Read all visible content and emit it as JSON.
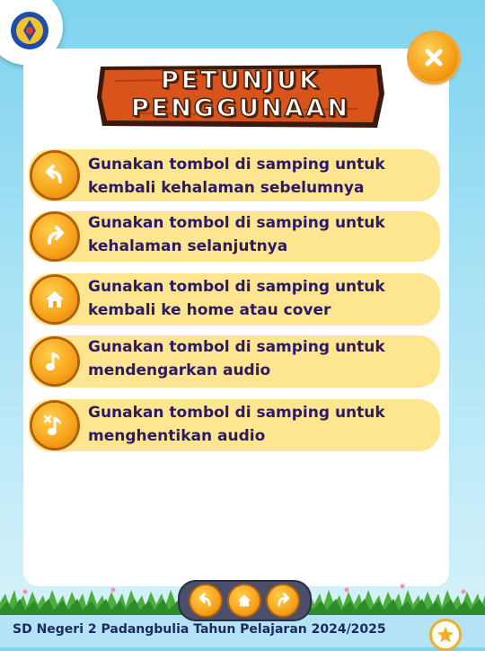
{
  "title": {
    "line1": "PETUNJUK",
    "line2": "PENGGUNAAN"
  },
  "instructions": [
    {
      "icon": "back-arrow-icon",
      "text": "Gunakan tombol di samping untuk kembali kehalaman sebelumnya"
    },
    {
      "icon": "next-arrow-icon",
      "text": "Gunakan tombol di samping untuk kehalaman selanjutnya"
    },
    {
      "icon": "home-icon",
      "text": "Gunakan tombol di samping untuk kembali ke home atau cover"
    },
    {
      "icon": "music-note-icon",
      "text": "Gunakan tombol di samping untuk mendengarkan audio"
    },
    {
      "icon": "music-mute-icon",
      "text": "Gunakan tombol di samping untuk menghentikan audio"
    }
  ],
  "footer": {
    "text": "SD Negeri 2 Padangbulia Tahun Pelajaran 2024/2025"
  },
  "nav": {
    "buttons": [
      "back-arrow-icon",
      "home-icon",
      "next-arrow-icon"
    ]
  },
  "colors": {
    "accent": "#f7a21b",
    "item_bg": "#fde68f",
    "text": "#2b1a66",
    "board": "#d9541a"
  }
}
